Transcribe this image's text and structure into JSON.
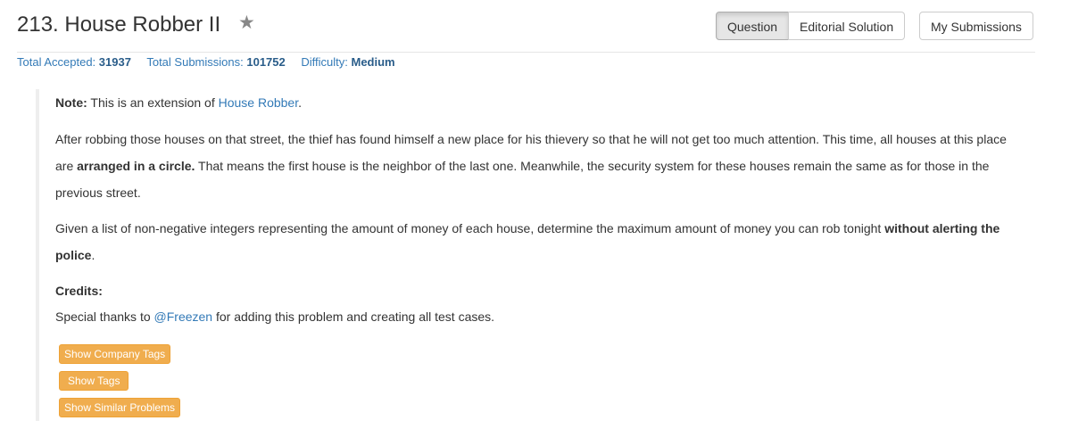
{
  "header": {
    "title": "213. House Robber II",
    "star_icon": "star-icon",
    "tabs": [
      {
        "label": "Question",
        "active": true
      },
      {
        "label": "Editorial Solution",
        "active": false
      }
    ],
    "submissions_label": "My Submissions"
  },
  "stats": {
    "accepted_label": "Total Accepted:",
    "accepted_value": "31937",
    "submissions_label": "Total Submissions:",
    "submissions_value": "101752",
    "difficulty_label": "Difficulty:",
    "difficulty_value": "Medium"
  },
  "question": {
    "note_label": "Note:",
    "note_text": " This is an extension of ",
    "note_link": "House Robber",
    "note_end": ".",
    "desc_1": "After robbing those houses on that street, the thief has found himself a new place for his thievery so that he will not get too much attention. This time, all houses at this place are ",
    "desc_bold": "arranged in a circle.",
    "desc_2": " That means the first house is the neighbor of the last one. Meanwhile, the security system for these houses remain the same as for those in the previous street.",
    "given_1": "Given a list of non-negative integers representing the amount of money of each house, determine the maximum amount of money you can rob tonight ",
    "given_bold": "without alerting the police",
    "given_end": ".",
    "credits_label": "Credits:",
    "thanks_1": "Special thanks to ",
    "thanks_link": "@Freezen",
    "thanks_2": " for adding this problem and creating all test cases."
  },
  "buttons": {
    "company_tags": "Show Company Tags",
    "tags": "Show Tags",
    "similar": "Show Similar Problems"
  },
  "colors": {
    "link": "#337ab7",
    "warning_button": "#f0ad4e",
    "blockquote_border": "#eeeeee"
  }
}
